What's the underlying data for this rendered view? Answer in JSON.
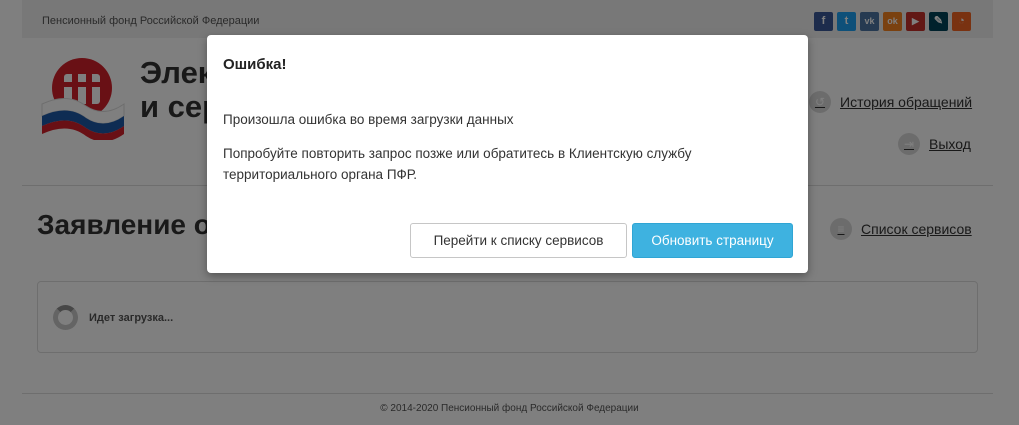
{
  "topbar": {
    "org_name": "Пенсионный фонд Российской Федерации",
    "social": [
      {
        "icon": "facebook-icon",
        "glyph": "f",
        "color": "#3b5998"
      },
      {
        "icon": "twitter-icon",
        "glyph": "t",
        "color": "#1da1f2"
      },
      {
        "icon": "vk-icon",
        "glyph": "vk",
        "color": "#4c75a3"
      },
      {
        "icon": "odnoklassniki-icon",
        "glyph": "ok",
        "color": "#f58220"
      },
      {
        "icon": "youtube-icon",
        "glyph": "▶",
        "color": "#c4302b"
      },
      {
        "icon": "livejournal-icon",
        "glyph": "✎",
        "color": "#004359"
      },
      {
        "icon": "rss-icon",
        "glyph": "◔",
        "color": "#f26522"
      }
    ]
  },
  "header": {
    "title_line1": "Элек",
    "title_line2": "и сер",
    "history_link": "История обращений",
    "logout_link": "Выход"
  },
  "main": {
    "heading": "Заявление о",
    "services_link": "Список сервисов",
    "loading_text": "Идет загрузка..."
  },
  "footer": {
    "copyright": "© 2014-2020 Пенсионный фонд Российской Федерации"
  },
  "modal": {
    "title": "Ошибка!",
    "message": "Произошла ошибка во время загрузки данных",
    "hint": "Попробуйте повторить запрос позже или обратитесь в Клиентскую службу территориального органа ПФР.",
    "btn_services": "Перейти к списку сервисов",
    "btn_refresh": "Обновить страницу"
  },
  "colors": {
    "primary": "#3eb2e0",
    "logo_red": "#d3202b",
    "flag_blue": "#1c58a6",
    "overlay": "rgba(0,0,0,0.5)"
  }
}
